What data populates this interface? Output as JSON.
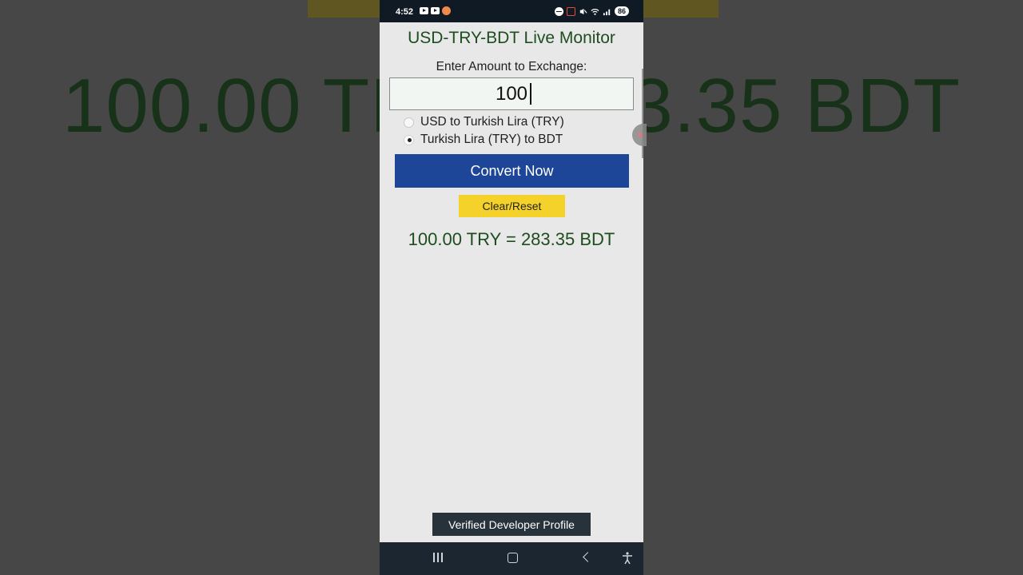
{
  "background": {
    "left_text": "100.00 TR",
    "right_text": "3.35 BDT"
  },
  "status_bar": {
    "time": "4:52",
    "battery": "86"
  },
  "app": {
    "title": "USD-TRY-BDT Live Monitor",
    "amount_label": "Enter Amount to Exchange:",
    "amount_value": "100",
    "options": [
      {
        "label": "USD to Turkish Lira (TRY)",
        "selected": false
      },
      {
        "label": "Turkish Lira (TRY) to BDT",
        "selected": true
      }
    ],
    "convert_label": "Convert Now",
    "reset_label": "Clear/Reset",
    "result": "100.00 TRY = 283.35 BDT",
    "verified_label": "Verified Developer Profile"
  },
  "colors": {
    "title_green": "#1e4d1f",
    "convert_blue": "#1e4698",
    "reset_yellow": "#f4d22a",
    "navbar": "#1b2631"
  },
  "nav": {
    "icons": [
      "recent-apps-icon",
      "home-icon",
      "back-icon",
      "accessibility-icon"
    ]
  }
}
